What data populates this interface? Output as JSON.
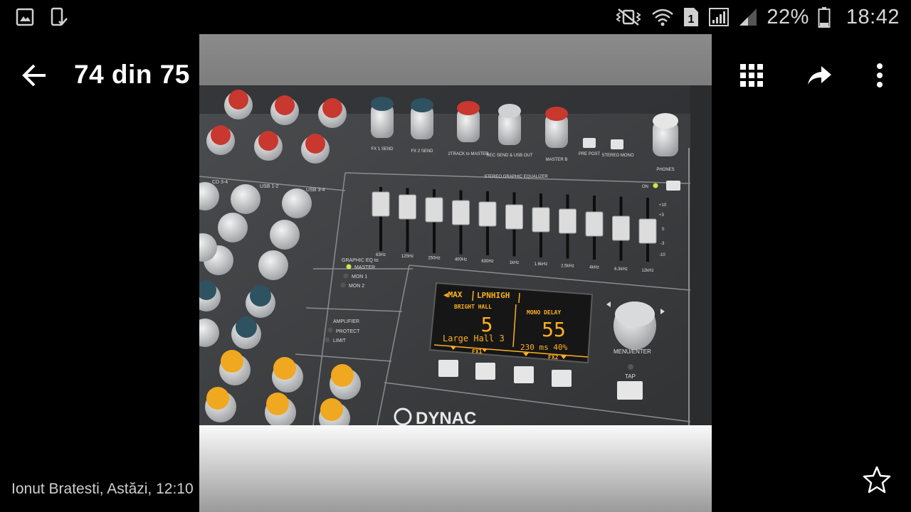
{
  "statusbar": {
    "battery": "22%",
    "time": "18:42",
    "sim_label": "1"
  },
  "toolbar": {
    "title": "74 din 75"
  },
  "footer": {
    "caption": "Ionut Bratesti, Astăzi, 12:10"
  },
  "photo": {
    "display": {
      "header_left": "◀MAX",
      "header_right": "LPNHIGH",
      "fx1_name": "BRIGHT HALL",
      "fx1_value": "5",
      "fx1_preset": "Large Hall 3",
      "fx1_label": "FX1",
      "fx2_name": "MONO DELAY",
      "fx2_value": "55",
      "fx2_detail": "230 ms  40%",
      "fx2_label": "FX2"
    },
    "eq_title": "STEREO GRAPHIC EQUALIZER",
    "eq_bands": [
      "63Hz",
      "125Hz",
      "250Hz",
      "400Hz",
      "630Hz",
      "1kHz",
      "1.6kHz",
      "2.5kHz",
      "4kHz",
      "6.3kHz",
      "12kHz"
    ],
    "eq_scale": [
      "+10",
      "+3",
      "0",
      "-3",
      "-10"
    ],
    "knob_labels": [
      "FX 1 SEND",
      "FX 2 SEND",
      "2TRACK to MASTER",
      "REC SEND & USB OUT",
      "MASTER B",
      "PHONES"
    ],
    "switch_labels": [
      "PRE POST",
      "STEREO MONO"
    ],
    "eq_on_label": "ON",
    "graphic_eq_title": "GRAPHIC EQ to",
    "graphic_eq_options": [
      "MASTER",
      "MON 1",
      "MON 2"
    ],
    "amplifier_title": "AMPLIFIER",
    "amplifier_leds": [
      "PROTECT",
      "LIMIT"
    ],
    "menu_label": "MENU/ENTER",
    "tap_label": "TAP",
    "channel_labels": [
      "CD 3-4",
      "USB 1-2",
      "USB 3-4"
    ],
    "brand": "DYNAC"
  },
  "colors": {
    "background": "#000000",
    "panel": "#3a3c3e",
    "lcd": "#ffb020",
    "knob_red": "#c8382e",
    "knob_teal": "#2e5260",
    "knob_yellow": "#f0a820"
  },
  "icons": {
    "status_left": [
      "gallery-icon",
      "device-check-icon"
    ],
    "status_right": [
      "vibrate-mute-icon",
      "wifi-icon",
      "sim-icon",
      "signal-icon",
      "signal-weak-icon",
      "battery-icon"
    ],
    "toolbar": [
      "back-arrow-icon",
      "grid-icon",
      "share-icon",
      "more-vert-icon"
    ],
    "footer": [
      "star-icon"
    ]
  }
}
